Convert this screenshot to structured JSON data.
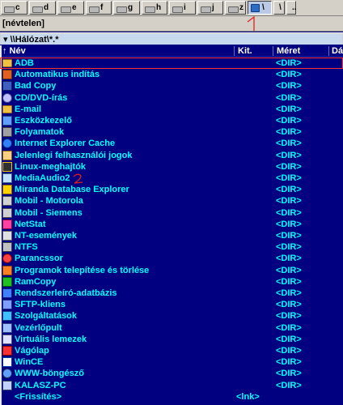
{
  "drives": [
    {
      "letter": "c",
      "active": false
    },
    {
      "letter": "d",
      "active": false
    },
    {
      "letter": "e",
      "active": false
    },
    {
      "letter": "f",
      "active": false
    },
    {
      "letter": "g",
      "active": false
    },
    {
      "letter": "h",
      "active": false
    },
    {
      "letter": "i",
      "active": false
    },
    {
      "letter": "j",
      "active": false
    },
    {
      "letter": "z",
      "active": false
    },
    {
      "letter": "\\",
      "active": true
    },
    {
      "letter": "\\",
      "active": false
    },
    {
      "letter": "..",
      "active": false
    }
  ],
  "path_bar": {
    "label": "[névtelen]"
  },
  "annotations": {
    "mark_1": "1",
    "mark_2": "2",
    "color": "#e02020"
  },
  "location": {
    "path": "▾ \\\\Hálózat\\*.*"
  },
  "columns": {
    "name": "↑ Név",
    "ext": "Kit.",
    "size": "Méret",
    "date": "Dá"
  },
  "files": [
    {
      "name": "ADB",
      "size": "<DIR>",
      "icon": "folder-icon",
      "selected": true
    },
    {
      "name": "Automatikus indítás",
      "size": "<DIR>",
      "icon": "torch-icon"
    },
    {
      "name": "Bad Copy",
      "size": "<DIR>",
      "icon": "floppy-icon"
    },
    {
      "name": "CD/DVD-írás",
      "size": "<DIR>",
      "icon": "cd-icon"
    },
    {
      "name": "E-mail",
      "size": "<DIR>",
      "icon": "folder-icon"
    },
    {
      "name": "Eszközkezelő",
      "size": "<DIR>",
      "icon": "device-icon"
    },
    {
      "name": "Folyamatok",
      "size": "<DIR>",
      "icon": "gears-icon"
    },
    {
      "name": "Internet Explorer Cache",
      "size": "<DIR>",
      "icon": "ie-icon"
    },
    {
      "name": "Jelenlegi felhasználói jogok",
      "size": "<DIR>",
      "icon": "user-icon"
    },
    {
      "name": "Linux-meghajtók",
      "size": "<DIR>",
      "icon": "penguin-icon"
    },
    {
      "name": "MediaAudio2",
      "size": "<DIR>",
      "icon": "media-icon"
    },
    {
      "name": "Miranda Database Explorer",
      "size": "<DIR>",
      "icon": "database-icon"
    },
    {
      "name": "Mobil - Motorola",
      "size": "<DIR>",
      "icon": "phone-icon"
    },
    {
      "name": "Mobil - Siemens",
      "size": "<DIR>",
      "icon": "phone-icon"
    },
    {
      "name": "NetStat",
      "size": "<DIR>",
      "icon": "netstat-icon"
    },
    {
      "name": "NT-események",
      "size": "<DIR>",
      "icon": "log-icon"
    },
    {
      "name": "NTFS",
      "size": "<DIR>",
      "icon": "drive-icon"
    },
    {
      "name": "Parancssor",
      "size": "<DIR>",
      "icon": "prompt-icon"
    },
    {
      "name": "Programok telepítése és törlése",
      "size": "<DIR>",
      "icon": "installer-icon"
    },
    {
      "name": "RamCopy",
      "size": "<DIR>",
      "icon": "ram-icon"
    },
    {
      "name": "Rendszerleíró-adatbázis",
      "size": "<DIR>",
      "icon": "registry-icon"
    },
    {
      "name": "SFTP-kliens",
      "size": "<DIR>",
      "icon": "network-icon"
    },
    {
      "name": "Szolgáltatások",
      "size": "<DIR>",
      "icon": "services-icon"
    },
    {
      "name": "Vezérlőpult",
      "size": "<DIR>",
      "icon": "control-panel-icon"
    },
    {
      "name": "Virtuális lemezek",
      "size": "<DIR>",
      "icon": "virtual-disk-icon"
    },
    {
      "name": "Vágólap",
      "size": "<DIR>",
      "icon": "clipboard-icon"
    },
    {
      "name": "WinCE",
      "size": "<DIR>",
      "icon": "wince-icon"
    },
    {
      "name": "WWW-böngésző",
      "size": "<DIR>",
      "icon": "globe-icon"
    },
    {
      "name": "KALASZ-PC",
      "size": "<DIR>",
      "icon": "computer-icon"
    },
    {
      "name": "<Frissítés>",
      "size": "",
      "ext": "<lnk>",
      "icon": "none"
    }
  ]
}
